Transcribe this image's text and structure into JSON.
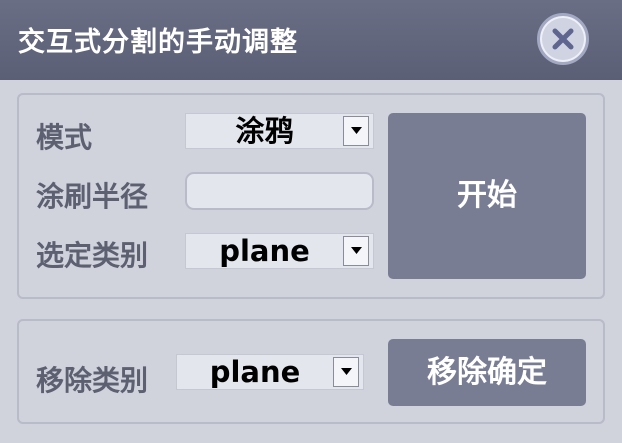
{
  "window": {
    "title": "交互式分割的手动调整",
    "close_icon": "close-icon"
  },
  "top_group": {
    "mode_label": "模式",
    "mode_value": "涂鸦",
    "brush_radius_label": "涂刷半径",
    "brush_radius_value": "",
    "select_class_label": "选定类别",
    "select_class_value": "plane",
    "start_button": "开始"
  },
  "bottom_group": {
    "remove_class_label": "移除类别",
    "remove_class_value": "plane",
    "remove_confirm_button": "移除确定"
  },
  "colors": {
    "titlebar": "#60647b",
    "background": "#d0d2dc",
    "button": "#787d94",
    "label": "#5d6070"
  }
}
